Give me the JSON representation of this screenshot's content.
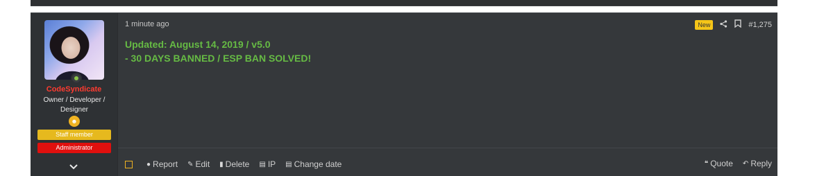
{
  "post": {
    "user": {
      "username": "CodeSyndicate",
      "title": "Owner / Developer / Designer",
      "banners": {
        "staff": "Staff member",
        "admin": "Administrator"
      }
    },
    "timestamp": "1 minute ago",
    "new_label": "New",
    "post_number": "#1,275",
    "body_lines": [
      "Updated: August 14, 2019 / v5.0",
      "- 30 DAYS BANNED / ESP BAN SOLVED!"
    ],
    "actions": {
      "report": "Report",
      "edit": "Edit",
      "delete": "Delete",
      "ip": "IP",
      "change_date": "Change date",
      "quote": "Quote",
      "reply": "Reply"
    }
  },
  "colors": {
    "post_bg": "#35383b",
    "user_bg": "#2e3134",
    "username": "#ff3b30",
    "body_text": "#66bb44",
    "staff_banner": "#e6b91e",
    "admin_banner": "#e0100e",
    "new_badge": "#f5c518"
  },
  "icons": {
    "share": "share-icon",
    "bookmark": "bookmark-icon",
    "report": "report-icon",
    "edit": "pencil-icon",
    "delete": "trash-icon",
    "ip": "id-card-icon",
    "change_date": "id-card-icon",
    "quote": "quote-icon",
    "reply": "reply-icon",
    "expand": "chevron-down-icon"
  }
}
